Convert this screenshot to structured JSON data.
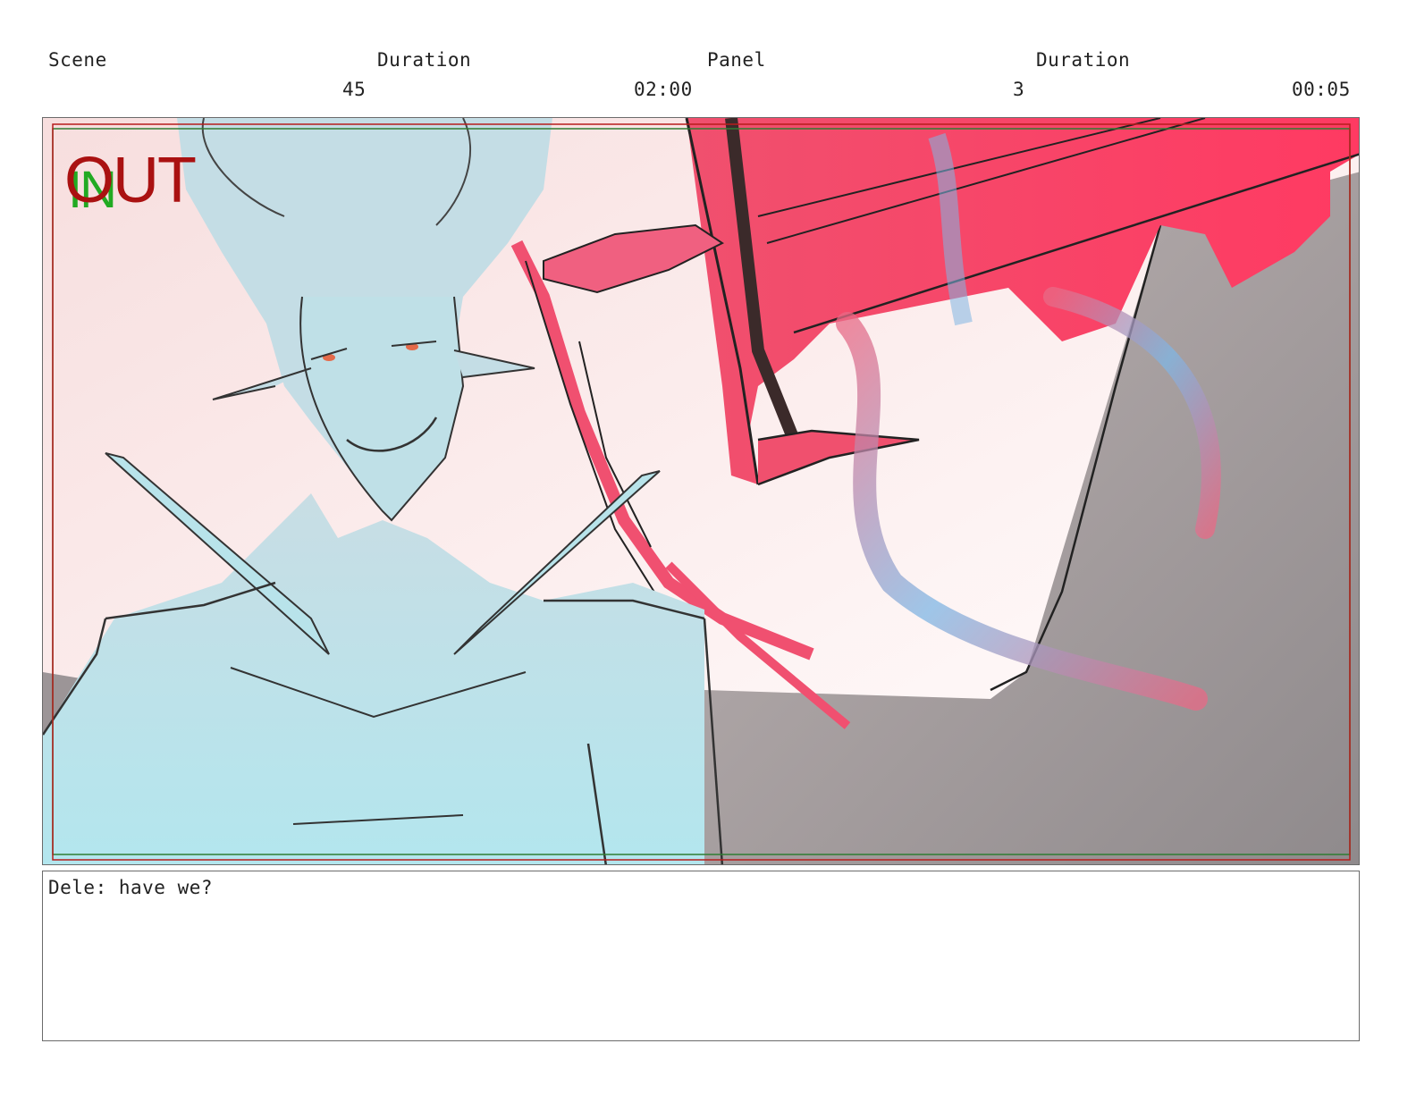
{
  "header": {
    "scene_label": "Scene",
    "scene_duration_label": "Duration",
    "panel_label": "Panel",
    "panel_duration_label": "Duration",
    "scene_number": "45",
    "scene_duration": "02:00",
    "panel_number": "3",
    "panel_duration": "00:05"
  },
  "panel": {
    "in_marker": "IN",
    "out_marker": "OUT",
    "safe_area_outer_color": "#2e7d32",
    "safe_area_inner_color": "#b71c1c",
    "in_color": "#22aa22",
    "out_color": "#aa1111"
  },
  "notes": {
    "dialogue": "Dele: have we?"
  },
  "icons": [
    "storyboard-artwork-image"
  ]
}
